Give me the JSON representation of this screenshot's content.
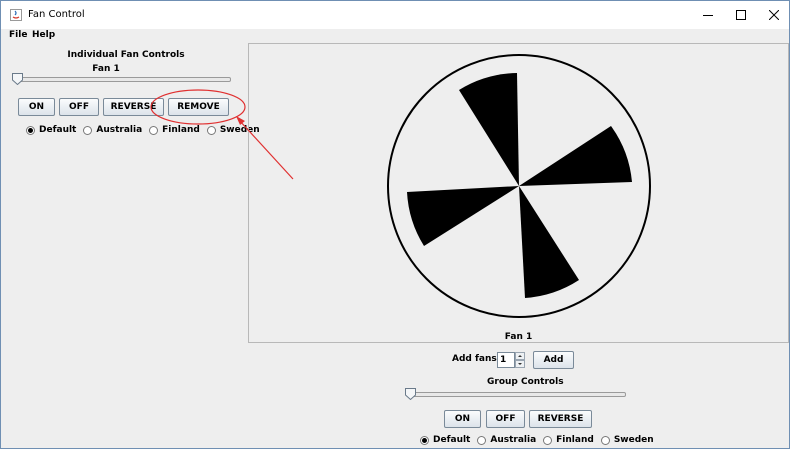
{
  "window": {
    "title": "Fan Control"
  },
  "menu": {
    "file": "File",
    "help": "Help"
  },
  "individual": {
    "heading": "Individual Fan Controls",
    "fan_label": "Fan 1",
    "speed_level": 0,
    "buttons": {
      "on": "ON",
      "off": "OFF",
      "reverse": "REVERSE",
      "remove": "REMOVE"
    },
    "radios": [
      {
        "label": "Default",
        "checked": true
      },
      {
        "label": "Australia",
        "checked": false
      },
      {
        "label": "Finland",
        "checked": false
      },
      {
        "label": "Sweden",
        "checked": false
      }
    ]
  },
  "fan_display": {
    "caption": "Fan 1",
    "blade_count": 4,
    "blade_color": "#000000"
  },
  "add": {
    "label": "Add fans:",
    "count": "1",
    "button": "Add"
  },
  "group": {
    "heading": "Group Controls",
    "speed_level": 0,
    "buttons": {
      "on": "ON",
      "off": "OFF",
      "reverse": "REVERSE"
    },
    "radios": [
      {
        "label": "Default",
        "checked": true
      },
      {
        "label": "Australia",
        "checked": false
      },
      {
        "label": "Finland",
        "checked": false
      },
      {
        "label": "Sweden",
        "checked": false
      }
    ]
  },
  "colors": {
    "annotation": "#e03030",
    "window_border": "#6f8fb3"
  }
}
